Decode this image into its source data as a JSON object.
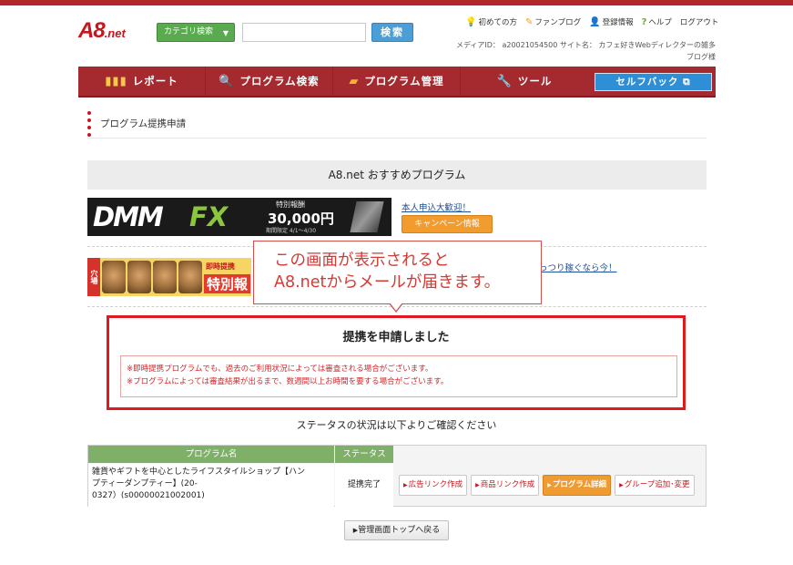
{
  "header": {
    "logo_main": "A8",
    "logo_sub": ".net",
    "category_search": "カテゴリ検索",
    "search_placeholder": "",
    "search_button": "検索",
    "links": [
      {
        "label": "初めての方",
        "icon": "lightbulb-icon"
      },
      {
        "label": "ファンブログ",
        "icon": "pencil-icon"
      },
      {
        "label": "登録情報",
        "icon": "person-icon"
      },
      {
        "label": "ヘルプ",
        "icon": "question-icon"
      },
      {
        "label": "ログアウト",
        "icon": ""
      }
    ],
    "media_line1": "メディアID： a20021054500 サイト名： カフェ好きWebディレクターの雑多",
    "media_line2": "ブログ様"
  },
  "nav": {
    "items": [
      {
        "label": "レポート",
        "icon": "chart-icon"
      },
      {
        "label": "プログラム検索",
        "icon": "magnifier-icon"
      },
      {
        "label": "プログラム管理",
        "icon": "folder-icon"
      },
      {
        "label": "ツール",
        "icon": "wrench-icon"
      }
    ],
    "selfback": "セルフバック"
  },
  "page": {
    "title": "プログラム提携申請"
  },
  "recommend": {
    "heading": "A8.net おすすめプログラム",
    "banner1": {
      "brand_dmm": "DMM",
      "brand_fx": "FX",
      "special_label": "特別報酬",
      "amount": "30,000円",
      "limit": "期間限定 4/1〜4/30",
      "link": "本人申込大歓迎！",
      "campaign_button": "キャンペーン情報"
    },
    "banner2": {
      "tab": "穴場",
      "sokuji": "即時提携",
      "tokubetsu": "特別報",
      "link": "っつり稼ぐなら今！"
    }
  },
  "callout": {
    "line1": "この画面が表示されると",
    "line2": "A8.netからメールが届きます。"
  },
  "result": {
    "title": "提携を申請しました",
    "notice1": "※即時提携プログラムでも、過去のご利用状況によっては審査される場合がございます。",
    "notice2": "※プログラムによっては審査結果が出るまで、数週間以上お時間を要する場合がございます。"
  },
  "status_note": "ステータスの状況は以下よりご確認ください",
  "table": {
    "headers": {
      "name": "プログラム名",
      "status": "ステータス"
    },
    "row": {
      "name_line1": "雑貨やギフトを中心としたライフスタイルショップ【ハン",
      "name_line2": "プティーダンプティー】(20-",
      "name_line3": "0327）(s00000021002001)",
      "status": "提携完了"
    },
    "actions": [
      "広告リンク作成",
      "商品リンク作成",
      "プログラム詳細",
      "グループ追加･変更"
    ]
  },
  "back_button": "管理画面トップへ戻る",
  "colors": {
    "brand_red": "#c8161d",
    "nav_red": "#a52a2f",
    "table_green": "#7eb067",
    "accent_orange": "#f09a32",
    "selfback_blue": "#2e8fd6"
  }
}
